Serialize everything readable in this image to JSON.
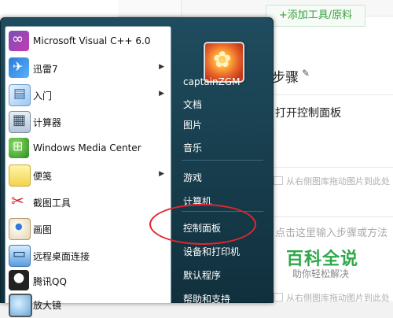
{
  "background_page": {
    "add_button": "+添加工具/原料",
    "section_title": "步骤",
    "step_text": "打开控制面板",
    "image_hint": "从右侧图库拖动图片到此处",
    "input_hint": "点击这里输入步骤或方法",
    "brand": "百科全说",
    "brand_sub": "助你轻松解决",
    "colors": {
      "brand": "#2ea84a",
      "accent": "#3aa23f"
    }
  },
  "start_menu": {
    "programs": [
      {
        "label": "Microsoft Visual C++ 6.0",
        "icon": "visual-cpp-icon",
        "submenu": false
      },
      {
        "label": "迅雷7",
        "icon": "thunder-icon",
        "submenu": true
      },
      {
        "label": "入门",
        "icon": "getting-started-icon",
        "submenu": true
      },
      {
        "label": "计算器",
        "icon": "calculator-icon",
        "submenu": false
      },
      {
        "label": "Windows Media Center",
        "icon": "media-center-icon",
        "submenu": false
      },
      {
        "label": "便笺",
        "icon": "sticky-notes-icon",
        "submenu": true
      },
      {
        "label": "截图工具",
        "icon": "snipping-tool-icon",
        "submenu": false
      },
      {
        "label": "画图",
        "icon": "paint-icon",
        "submenu": false
      },
      {
        "label": "远程桌面连接",
        "icon": "remote-desktop-icon",
        "submenu": false
      },
      {
        "label": "腾讯QQ",
        "icon": "qq-icon",
        "submenu": false
      },
      {
        "label": "放大镜",
        "icon": "magnifier-icon",
        "submenu": false
      }
    ],
    "user_name": "captainZGM",
    "right_items": [
      {
        "label": "文档"
      },
      {
        "label": "图片"
      },
      {
        "label": "音乐"
      },
      {
        "label": "游戏"
      },
      {
        "label": "计算机"
      },
      {
        "label": "控制面板"
      },
      {
        "label": "设备和打印机"
      },
      {
        "label": "默认程序"
      },
      {
        "label": "帮助和支持"
      }
    ],
    "highlighted_item": "控制面板",
    "colors": {
      "panel": "#1f4c5e",
      "highlight_ring": "#e0262f"
    }
  }
}
